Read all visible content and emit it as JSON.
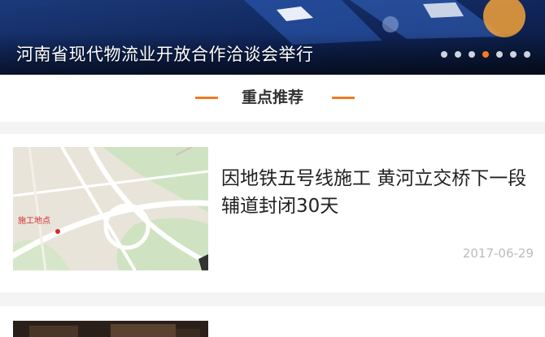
{
  "banner": {
    "title": "河南省现代物流业开放合作洽谈会举行",
    "slide_count": 7,
    "active_slide": 4,
    "colors": {
      "active_dot": "#f47b20",
      "inactive_dot": "#cfd3de"
    }
  },
  "section": {
    "title": "重点推荐",
    "accent": "#f47b20"
  },
  "news": [
    {
      "title": "因地铁五号线施工 黄河立交桥下一段辅道封闭30天",
      "date": "2017-06-29",
      "thumbnail": "map-thumbnail",
      "map_label": "施工地点"
    },
    {
      "title": "",
      "date": "",
      "thumbnail": "photo-thumbnail"
    }
  ]
}
